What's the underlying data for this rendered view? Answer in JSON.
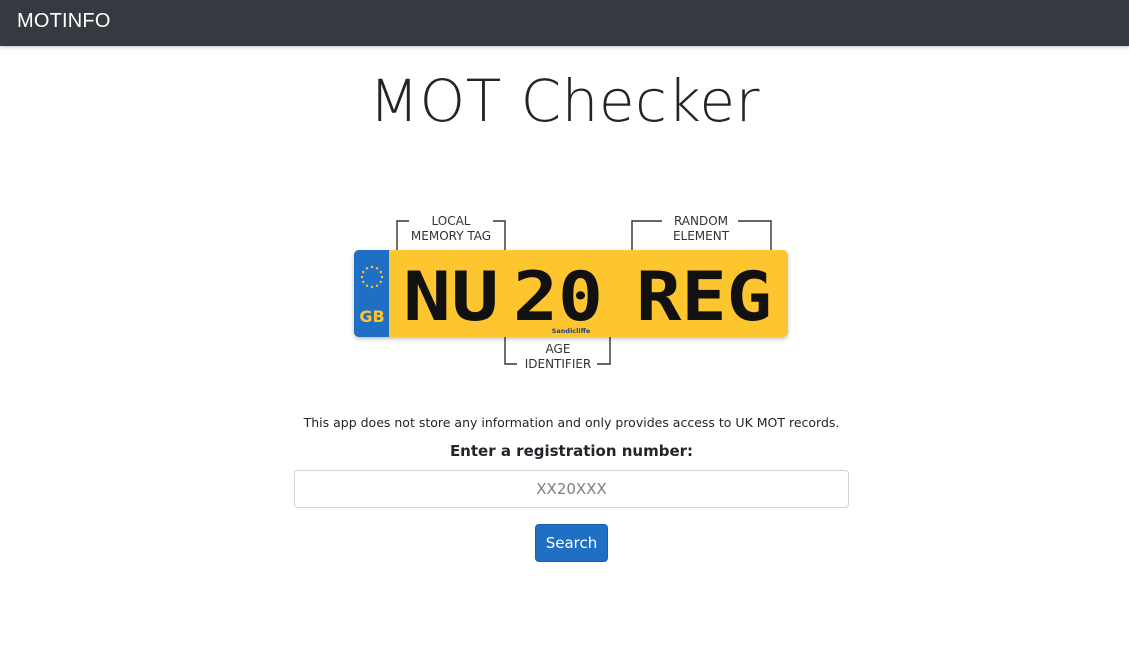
{
  "navbar": {
    "brand": "MOTINFO"
  },
  "main": {
    "title": "MOT Checker",
    "disclaimer": "This app does not store any information and only provides access to UK MOT records.",
    "registration_label": "Enter a registration number:",
    "registration_input": {
      "value": "",
      "placeholder": "XX20XXX"
    },
    "search_button_label": "Search"
  },
  "plate_diagram": {
    "country_code": "GB",
    "registration": {
      "local_memory_tag": "NU",
      "age_identifier": "20",
      "random_element": "REG"
    },
    "dealer_text": "Sandicliffe",
    "annotations": {
      "local_memory_tag": [
        "LOCAL",
        "MEMORY TAG"
      ],
      "random_element": [
        "RANDOM",
        "ELEMENT"
      ],
      "age_identifier": [
        "AGE",
        "IDENTIFIER"
      ]
    },
    "colors": {
      "plate_yellow": "#fdc52e",
      "eu_band_blue": "#1f6fc5",
      "band_text": "#fdc52e",
      "characters": "#111111"
    }
  },
  "colors": {
    "navbar_bg": "#343a40",
    "primary_button": "#1f6fc5"
  }
}
